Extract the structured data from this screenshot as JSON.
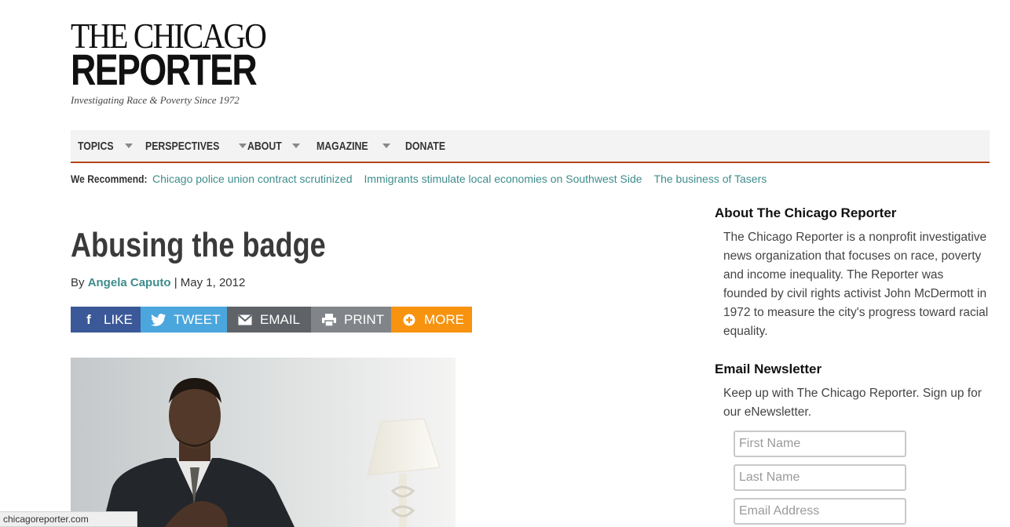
{
  "masthead": {
    "line1": "THE CHICAGO",
    "line2": "REPORTER",
    "tagline": "Investigating Race & Poverty Since 1972"
  },
  "nav": {
    "topics": "TOPICS",
    "perspectives": "PERSPECTIVES",
    "about": "ABOUT",
    "magazine": "MAGAZINE",
    "donate": "DONATE"
  },
  "recommend": {
    "label": "We Recommend:",
    "links": [
      "Chicago police union contract scrutinized",
      "Immigrants stimulate local economies on Southwest Side",
      "The business of Tasers"
    ]
  },
  "article": {
    "title": "Abusing the badge",
    "by": "By",
    "author": "Angela Caputo",
    "separator": "|",
    "date": "May 1, 2012"
  },
  "share": {
    "like": "LIKE",
    "tweet": "TWEET",
    "email": "EMAIL",
    "print": "PRINT",
    "more": "MORE"
  },
  "sidebar": {
    "about_heading": "About The Chicago Reporter",
    "about_text": "The Chicago Reporter is a nonprofit investigative news organization that focuses on race, poverty and income inequality. The Reporter was founded by civil rights activist John McDermott in 1972 to measure the city's progress toward racial equality.",
    "newsletter_heading": "Email Newsletter",
    "newsletter_text": "Keep up with The Chicago Reporter. Sign up for our eNewsletter.",
    "first_name_placeholder": "First Name",
    "last_name_placeholder": "Last Name",
    "email_placeholder": "Email Address"
  },
  "status_url": "chicagoreporter.com",
  "colors": {
    "accent_rule": "#b5451b",
    "link": "#3f8c8c",
    "facebook": "#3b5998",
    "twitter": "#4ba6dd",
    "email": "#5f6368",
    "print": "#818589",
    "more": "#f7930f"
  }
}
